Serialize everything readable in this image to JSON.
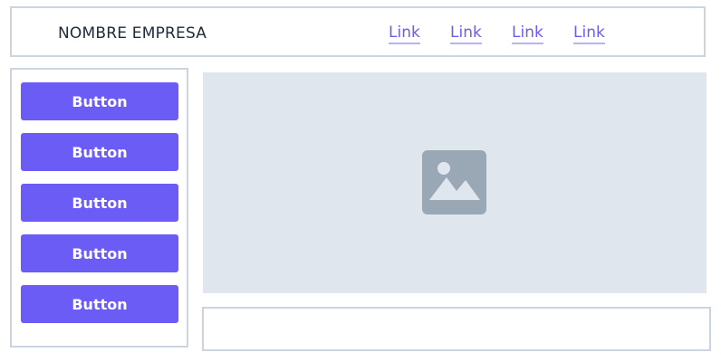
{
  "header": {
    "brand": "NOMBRE EMPRESA",
    "links": [
      "Link",
      "Link",
      "Link",
      "Link"
    ]
  },
  "sidebar": {
    "buttons": [
      "Button",
      "Button",
      "Button",
      "Button",
      "Button"
    ]
  },
  "main": {
    "image_icon": "image-placeholder-icon"
  },
  "colors": {
    "accent": "#6b5cf6",
    "border": "#cbd5e1",
    "placeholder_bg": "#e0e6ed",
    "placeholder_icon": "#9aa8b6"
  }
}
